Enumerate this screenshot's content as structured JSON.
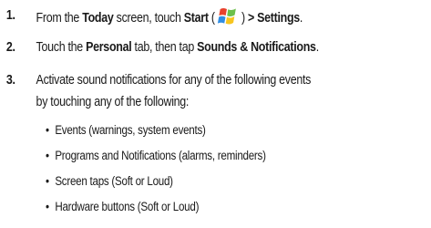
{
  "steps": [
    {
      "num": "1.",
      "t1": "From the ",
      "b1": "Today",
      "t2": " screen, touch ",
      "b2": "Start",
      "t3": " (",
      "t4": ") ",
      "b3": "> Settings",
      "t5": "."
    },
    {
      "num": "2.",
      "t1": "Touch the ",
      "b1": "Personal",
      "t2": " tab, then tap ",
      "b2": "Sounds & Notifications",
      "t3": "."
    },
    {
      "num": "3.",
      "line1": "Activate sound notifications for any of the following events",
      "line2": "by touching any of the following:"
    }
  ],
  "bullets": [
    "Events (warnings, system events)",
    "Programs and Notifications (alarms, reminders)",
    "Screen taps (Soft or Loud)",
    "Hardware buttons (Soft or Loud)"
  ],
  "icons": {
    "start": "windows-start-logo-icon"
  },
  "colors": {
    "text": "#1a1a1a",
    "logo_red": "#e8412c",
    "logo_green": "#6cc04a",
    "logo_blue": "#2f8de4",
    "logo_yellow": "#f7c51e"
  }
}
